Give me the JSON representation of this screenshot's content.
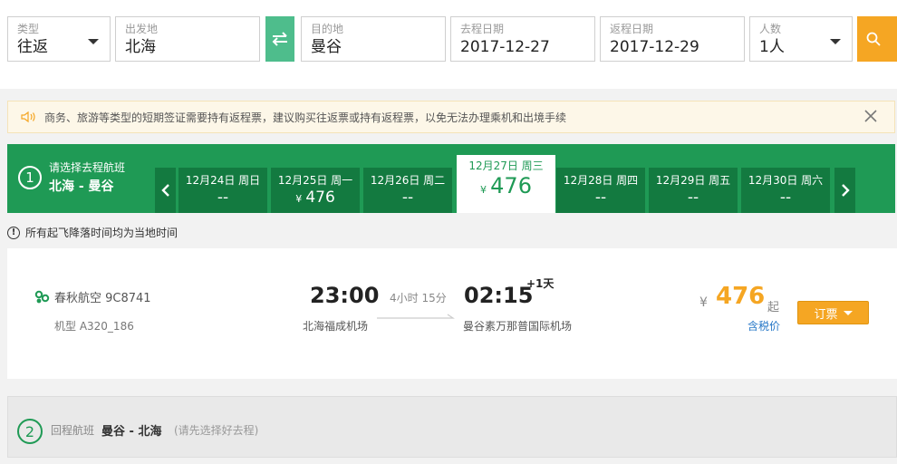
{
  "search": {
    "type_label": "类型",
    "type_value": "往返",
    "from_label": "出发地",
    "from_value": "北海",
    "to_label": "目的地",
    "to_value": "曼谷",
    "depart_label": "去程日期",
    "depart_value": "2017-12-27",
    "return_label": "返程日期",
    "return_value": "2017-12-29",
    "pax_label": "人数",
    "pax_value": "1人",
    "swap_icon": "swap-icon",
    "search_icon": "search-icon"
  },
  "notice": {
    "text": "商务、旅游等类型的短期签证需要持有返程票，建议购买往返票或持有返程票，以免无法办理乘机和出境手续",
    "icon": "speaker-icon",
    "close_icon": "close-icon"
  },
  "outbound": {
    "step": "1",
    "title": "请选择去程航班",
    "route": "北海 - 曼谷",
    "dates": [
      {
        "date": "12月24日 周日",
        "price": "--"
      },
      {
        "date": "12月25日 周一",
        "yen": "¥",
        "price": "476"
      },
      {
        "date": "12月26日 周二",
        "price": "--"
      },
      {
        "date": "12月27日 周三",
        "yen": "¥",
        "price": "476"
      },
      {
        "date": "12月28日 周四",
        "price": "--"
      },
      {
        "date": "12月29日 周五",
        "price": "--"
      },
      {
        "date": "12月30日 周六",
        "price": "--"
      }
    ],
    "selected_index": 3
  },
  "timezone_note": "所有起飞降落时间均为当地时间",
  "flight": {
    "airline": "春秋航空 9C8741",
    "model": "机型 A320_186",
    "dep_time": "23:00",
    "dep_airport": "北海福成机场",
    "duration": "4小时 15分",
    "arr_time": "02:15",
    "next_day": "+1天",
    "arr_airport": "曼谷素万那普国际机场",
    "yen": "¥",
    "price": "476",
    "price_suffix": "起",
    "tax_note": "含税价",
    "book_label": "订票"
  },
  "return_leg": {
    "step": "2",
    "label": "回程航班",
    "route": "曼谷 - 北海",
    "hint": "(请先选择好去程)"
  },
  "colors": {
    "green": "#1f9a55",
    "dark_green": "#137a40",
    "orange": "#f5a623",
    "swap": "#4ebd8c"
  }
}
